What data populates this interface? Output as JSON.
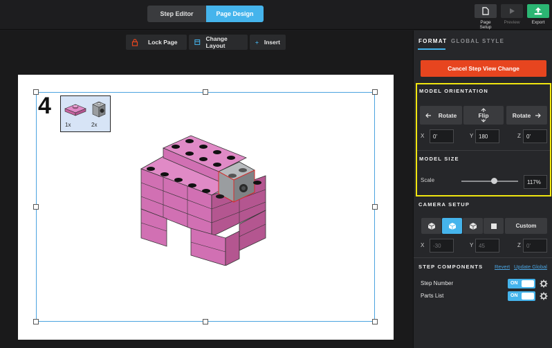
{
  "topbar": {
    "mode_tabs": [
      {
        "label": "Step Editor",
        "active": false
      },
      {
        "label": "Page Design",
        "active": true
      }
    ],
    "page_setup_label": "Page Setup",
    "preview_label": "Preview",
    "export_label": "Export"
  },
  "canvas_toolbar": {
    "lock_page": "Lock Page",
    "change_layout": "Change Layout",
    "insert": "Insert"
  },
  "page": {
    "step_number": "4",
    "parts": [
      {
        "qty": "1x",
        "color": "#d170b3"
      },
      {
        "qty": "2x",
        "color": "#8f9396"
      }
    ]
  },
  "panel": {
    "tabs": [
      {
        "label": "FORMAT",
        "active": true
      },
      {
        "label": "GLOBAL STYLE",
        "active": false
      }
    ],
    "cancel_button": "Cancel Step View Change",
    "model_orientation": {
      "title": "MODEL ORIENTATION",
      "rotate_left": "Rotate",
      "flip": "Flip",
      "rotate_right": "Rotate",
      "x_label": "X",
      "x_value": "0'",
      "y_label": "Y",
      "y_value": "180",
      "z_label": "Z",
      "z_value": "0'"
    },
    "model_size": {
      "title": "MODEL SIZE",
      "scale_label": "Scale",
      "scale_value": "117%",
      "scale_fraction": 0.58
    },
    "camera_setup": {
      "title": "CAMERA SETUP",
      "custom_label": "Custom",
      "x_label": "X",
      "x_value": "-30",
      "y_label": "Y",
      "y_value": "45",
      "z_label": "Z",
      "z_value": "0'"
    },
    "step_components": {
      "title": "STEP COMPONENTS",
      "revert": "Revert",
      "update_global": "Update Global",
      "items": [
        {
          "label": "Step Number",
          "toggle": "ON"
        },
        {
          "label": "Parts List",
          "toggle": "ON"
        }
      ]
    }
  },
  "colors": {
    "accent": "#45b4ec",
    "danger": "#e7451f",
    "export": "#2bb673",
    "highlight": "#f1e60f",
    "brick": "#d170b3"
  }
}
